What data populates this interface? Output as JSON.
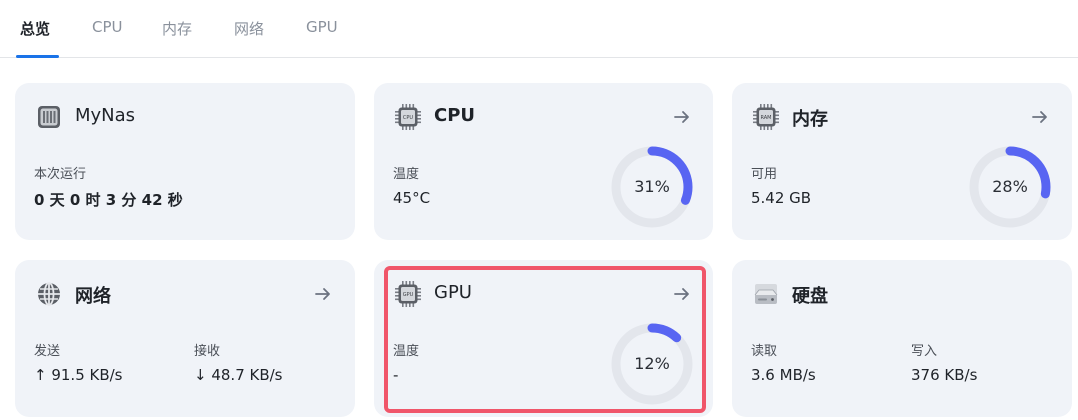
{
  "tabs": [
    {
      "label": "总览",
      "active": true
    },
    {
      "label": "CPU",
      "active": false
    },
    {
      "label": "内存",
      "active": false
    },
    {
      "label": "网络",
      "active": false
    },
    {
      "label": "GPU",
      "active": false
    }
  ],
  "system": {
    "title": "MyNas",
    "uptime_label": "本次运行",
    "uptime_value": "0 天 0 时 3 分 42 秒",
    "icon": "server-icon"
  },
  "cpu": {
    "title": "CPU",
    "temp_label": "温度",
    "temp_value": "45°C",
    "usage_text": "31%",
    "usage_percent": 31,
    "icon": "cpu-chip-icon"
  },
  "memory": {
    "title": "内存",
    "avail_label": "可用",
    "avail_value": "5.42 GB",
    "usage_text": "28%",
    "usage_percent": 28,
    "icon": "ram-chip-icon"
  },
  "network": {
    "title": "网络",
    "send_label": "发送",
    "send_value": "↑ 91.5 KB/s",
    "recv_label": "接收",
    "recv_value": "↓ 48.7 KB/s",
    "icon": "globe-icon"
  },
  "gpu": {
    "title": "GPU",
    "temp_label": "温度",
    "temp_value": "-",
    "usage_text": "12%",
    "usage_percent": 12,
    "icon": "gpu-chip-icon"
  },
  "disk": {
    "title": "硬盘",
    "read_label": "读取",
    "read_value": "3.6 MB/s",
    "write_label": "写入",
    "write_value": "376 KB/s",
    "icon": "hard-disk-icon"
  },
  "colors": {
    "accent": "#5865f2",
    "ring_track": "#e3e6ec",
    "card_bg": "#f0f3f8",
    "highlight": "#f0566a",
    "tab_active_underline": "#1a73e8"
  }
}
